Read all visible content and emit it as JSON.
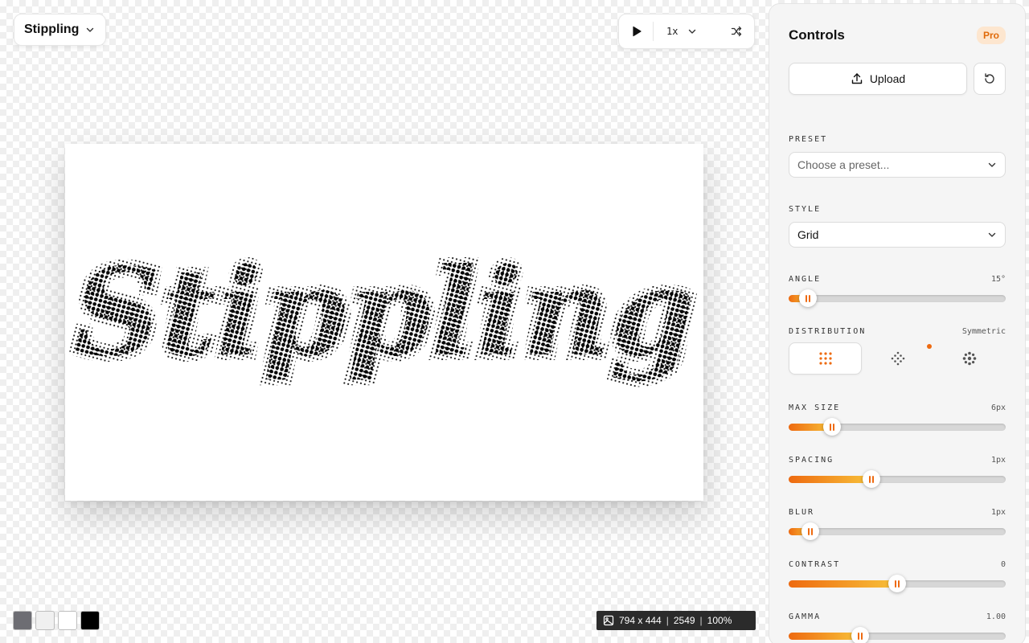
{
  "app": {
    "title": "Stippling"
  },
  "playback": {
    "speed": "1x"
  },
  "canvas": {
    "text": "Stippling"
  },
  "swatches": [
    {
      "name": "gray",
      "color": "#6d6d73"
    },
    {
      "name": "light-gray",
      "color": "#f0f0f0"
    },
    {
      "name": "white",
      "color": "#ffffff"
    },
    {
      "name": "black",
      "color": "#000000"
    }
  ],
  "info": {
    "size": "794 x 444",
    "count": "2549",
    "zoom": "100%"
  },
  "panel": {
    "title": "Controls",
    "badge": "Pro",
    "upload_label": "Upload",
    "preset": {
      "label": "PRESET",
      "placeholder": "Choose a preset..."
    },
    "style": {
      "label": "STYLE",
      "value": "Grid"
    },
    "angle": {
      "label": "ANGLE",
      "value": "15°",
      "fraction": 0.09
    },
    "distribution": {
      "label": "DISTRIBUTION",
      "value": "Symmetric"
    },
    "max_size": {
      "label": "MAX SIZE",
      "value": "6px",
      "fraction": 0.2
    },
    "spacing": {
      "label": "SPACING",
      "value": "1px",
      "fraction": 0.38
    },
    "blur": {
      "label": "BLUR",
      "value": "1px",
      "fraction": 0.1
    },
    "contrast": {
      "label": "CONTRAST",
      "value": "0",
      "fraction": 0.5
    },
    "gamma": {
      "label": "GAMMA",
      "value": "1.00",
      "fraction": 0.33
    }
  },
  "colors": {
    "accent": "#ee6a10",
    "accent_light": "#f8c23a"
  }
}
